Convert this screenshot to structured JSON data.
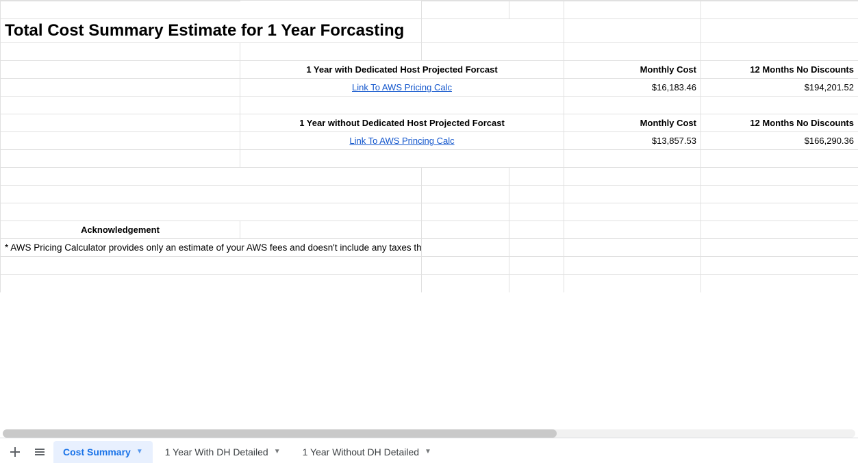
{
  "title": "Total Cost Summary Estimate for 1 Year Forcasting",
  "section1": {
    "heading": "1 Year with Dedicated Host Projected Forcast",
    "monthly_label": "Monthly Cost",
    "annual_label": "12 Months No Discounts",
    "link_text": "Link To AWS Pricing Calc",
    "monthly_cost": "$16,183.46",
    "annual_cost": "$194,201.52"
  },
  "section2": {
    "heading": "1 Year without Dedicated Host Projected Forcast",
    "monthly_label": "Monthly Cost",
    "annual_label": "12 Months No Discounts",
    "link_text": "Link To AWS Princing Calc",
    "monthly_cost": "$13,857.53",
    "annual_cost": "$166,290.36"
  },
  "ack": {
    "heading": "Acknowledgement",
    "body": "* AWS Pricing Calculator provides only an estimate of your AWS fees and doesn't include any taxes that might apply. Your actual fees depend on a variety of factors, including your actual usage of AWS services. Forcasted utilization of all resouces in this TCO Analysis are developed with exisiting data made available to Mission during the Assessement Phase. Due to the nature of this report, Mission cannot guarantee the final numbers represented since it is based upon theoretical resouce utilization."
  },
  "tabs": {
    "active": "Cost Summary",
    "others": [
      "1 Year With DH Detailed",
      "1 Year Without DH Detailed"
    ]
  }
}
